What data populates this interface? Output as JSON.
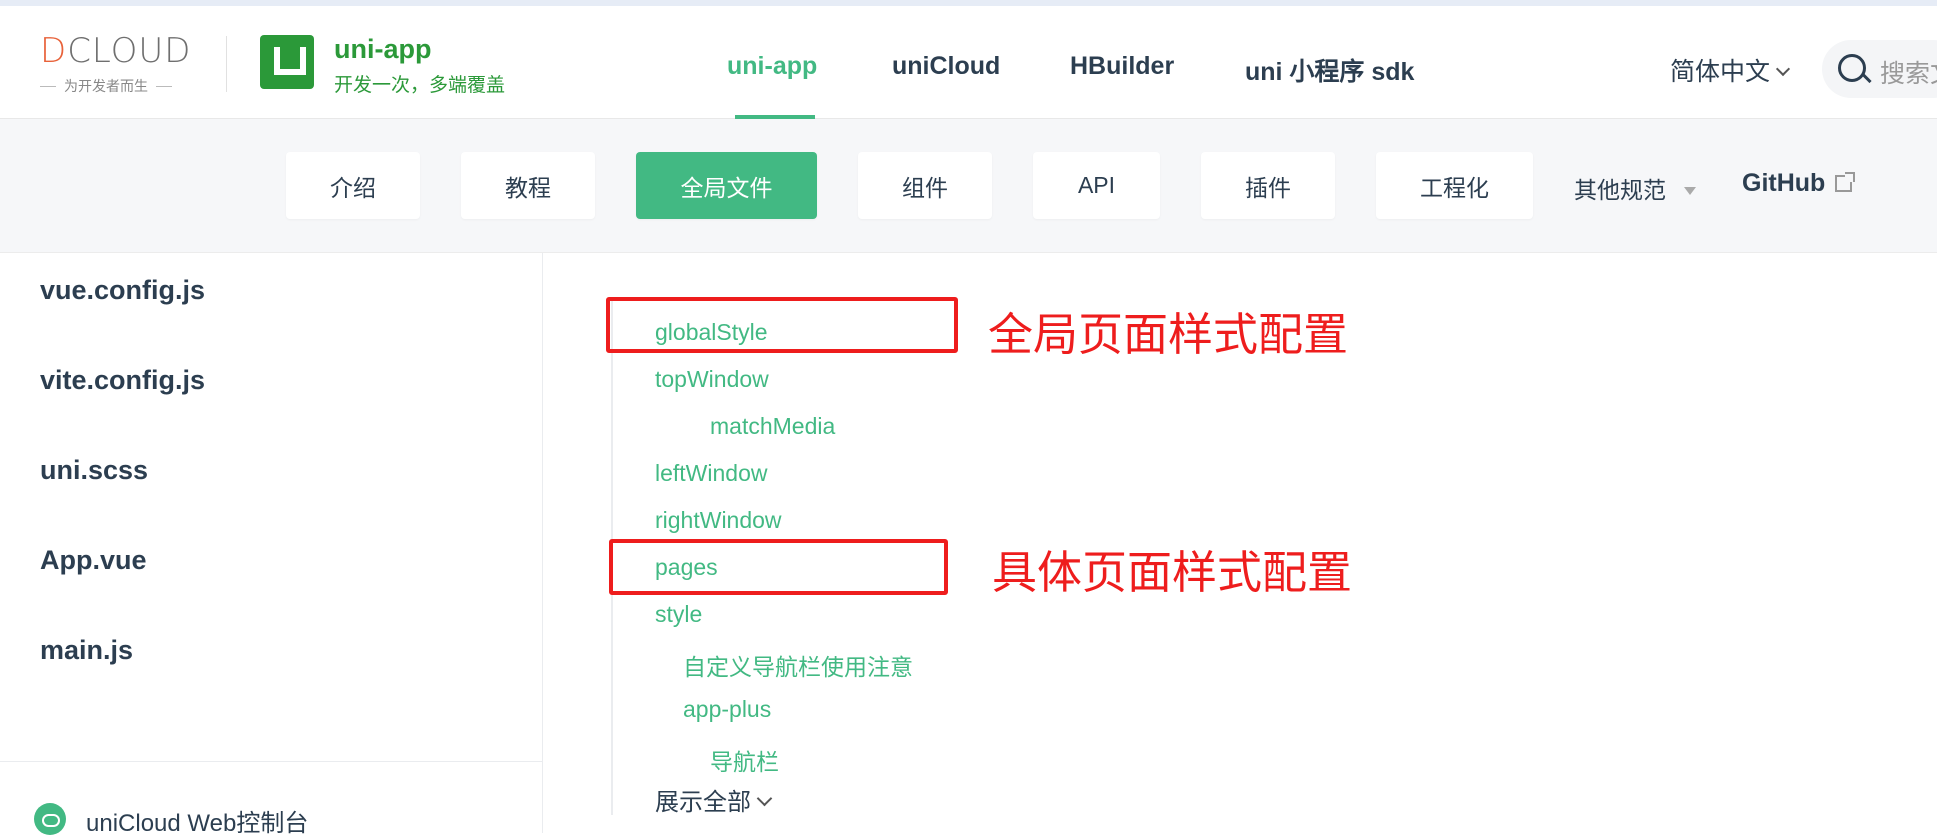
{
  "header": {
    "dcloud_logo_text": "DCLOUD",
    "dcloud_logo_first": "D",
    "dcloud_logo_rest": "CLOUD",
    "dcloud_tagline": "为开发者而生",
    "product_title": "uni-app",
    "product_subtitle": "开发一次，多端覆盖",
    "nav": [
      {
        "label": "uni-app",
        "active": true
      },
      {
        "label": "uniCloud",
        "active": false
      },
      {
        "label": "HBuilder",
        "active": false
      },
      {
        "label": "uni 小程序 sdk",
        "active": false
      }
    ],
    "language": "简体中文",
    "search_placeholder": "搜索文"
  },
  "subnav": {
    "tabs": [
      {
        "label": "介绍",
        "active": false
      },
      {
        "label": "教程",
        "active": false
      },
      {
        "label": "全局文件",
        "active": true
      },
      {
        "label": "组件",
        "active": false
      },
      {
        "label": "API",
        "active": false
      },
      {
        "label": "插件",
        "active": false
      },
      {
        "label": "工程化",
        "active": false
      }
    ],
    "more_label": "其他规范",
    "github_label": "GitHub"
  },
  "sidebar": {
    "items": [
      "vue.config.js",
      "vite.config.js",
      "uni.scss",
      "App.vue",
      "main.js"
    ],
    "footer_label": "uniCloud Web控制台"
  },
  "toc": {
    "items": [
      {
        "label": "globalStyle",
        "level": 1
      },
      {
        "label": "topWindow",
        "level": 1
      },
      {
        "label": "matchMedia",
        "level": 3
      },
      {
        "label": "leftWindow",
        "level": 1
      },
      {
        "label": "rightWindow",
        "level": 1
      },
      {
        "label": "pages",
        "level": 1
      },
      {
        "label": "style",
        "level": 1
      },
      {
        "label": "自定义导航栏使用注意",
        "level": 2
      },
      {
        "label": "app-plus",
        "level": 2
      },
      {
        "label": "导航栏",
        "level": 3
      }
    ],
    "show_all": "展示全部"
  },
  "annotations": {
    "global_style": "全局页面样式配置",
    "page_style": "具体页面样式配置",
    "color": "#ee1d1d"
  },
  "colors": {
    "accent": "#42b983",
    "brand_green": "#2b9939",
    "text": "#2c3e50"
  }
}
